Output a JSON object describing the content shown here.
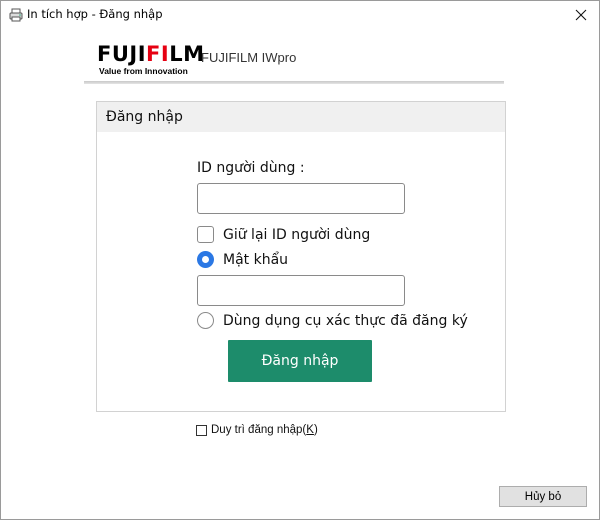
{
  "window": {
    "title": "In tích hợp - Đăng nhập",
    "icons": {
      "app": "printer-icon",
      "close": "close-icon"
    }
  },
  "brand": {
    "logo_prefix": "FUJI",
    "logo_accent": "FI",
    "logo_suffix": "LM",
    "tagline": "Value from Innovation",
    "product": "FUJIFILM IWpro",
    "colors": {
      "accent": "#e60012",
      "text": "#000000"
    }
  },
  "login_panel": {
    "header": "Đăng nhập",
    "user_id_label": "ID người dùng :",
    "user_id_value": "",
    "remember_id_label": "Giữ lại ID người dùng",
    "remember_id_checked": false,
    "password_option_label": "Mật khẩu",
    "password_option_selected": true,
    "password_value": "",
    "auth_tool_option_label": "Dùng dụng cụ xác thực đã đăng ký",
    "auth_tool_option_selected": false,
    "login_button_label": "Đăng nhập",
    "colors": {
      "login_button": "#1d8c6b",
      "radio_selected": "#2b78e4"
    }
  },
  "keep_signed_in": {
    "label": "Duy trì đăng nhập(",
    "accelerator": "K",
    "label_end": ")",
    "checked": false
  },
  "footer": {
    "cancel_label": "Hủy bỏ"
  }
}
